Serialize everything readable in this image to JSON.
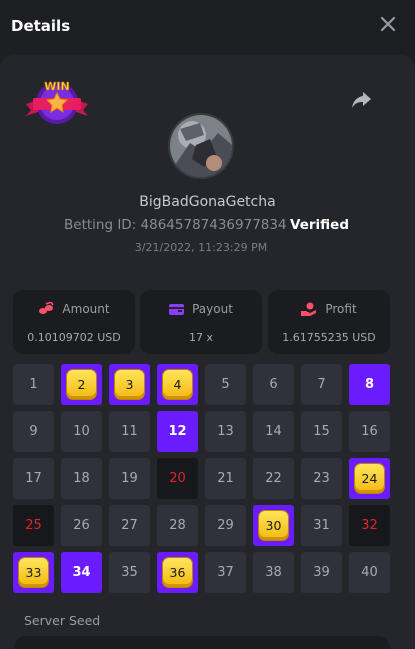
{
  "header": {
    "title": "Details"
  },
  "bet": {
    "username": "BigBadGonaGetcha",
    "betting_id_label": "Betting ID: 486457874369778‌34",
    "status": "Verified",
    "date": "3/21/2022, 11:23:29 PM"
  },
  "badge": {
    "text": "WIN"
  },
  "stats": {
    "amount": {
      "label": "Amount",
      "value": "0.10109702 USD"
    },
    "payout": {
      "label": "Payout",
      "value": "17 x"
    },
    "profit": {
      "label": "Profit",
      "value": "1.61755235 USD"
    }
  },
  "grid": [
    {
      "n": "1",
      "s": "normal"
    },
    {
      "n": "2",
      "s": "gem"
    },
    {
      "n": "3",
      "s": "gem"
    },
    {
      "n": "4",
      "s": "gem"
    },
    {
      "n": "5",
      "s": "normal"
    },
    {
      "n": "6",
      "s": "normal"
    },
    {
      "n": "7",
      "s": "normal"
    },
    {
      "n": "8",
      "s": "purple"
    },
    {
      "n": "9",
      "s": "normal"
    },
    {
      "n": "10",
      "s": "normal"
    },
    {
      "n": "11",
      "s": "normal"
    },
    {
      "n": "12",
      "s": "purple"
    },
    {
      "n": "13",
      "s": "normal"
    },
    {
      "n": "14",
      "s": "normal"
    },
    {
      "n": "15",
      "s": "normal"
    },
    {
      "n": "16",
      "s": "normal"
    },
    {
      "n": "17",
      "s": "normal"
    },
    {
      "n": "18",
      "s": "normal"
    },
    {
      "n": "19",
      "s": "normal"
    },
    {
      "n": "20",
      "s": "dark"
    },
    {
      "n": "21",
      "s": "normal"
    },
    {
      "n": "22",
      "s": "normal"
    },
    {
      "n": "23",
      "s": "normal"
    },
    {
      "n": "24",
      "s": "gem"
    },
    {
      "n": "25",
      "s": "dark"
    },
    {
      "n": "26",
      "s": "normal"
    },
    {
      "n": "27",
      "s": "normal"
    },
    {
      "n": "28",
      "s": "normal"
    },
    {
      "n": "29",
      "s": "normal"
    },
    {
      "n": "30",
      "s": "gem"
    },
    {
      "n": "31",
      "s": "normal"
    },
    {
      "n": "32",
      "s": "dark"
    },
    {
      "n": "33",
      "s": "gem"
    },
    {
      "n": "34",
      "s": "purple"
    },
    {
      "n": "35",
      "s": "normal"
    },
    {
      "n": "36",
      "s": "gem"
    },
    {
      "n": "37",
      "s": "normal"
    },
    {
      "n": "38",
      "s": "normal"
    },
    {
      "n": "39",
      "s": "normal"
    },
    {
      "n": "40",
      "s": "normal"
    }
  ],
  "seed": {
    "label": "Server Seed"
  },
  "colors": {
    "accent_purple": "#6a1cff",
    "gem_yellow": "#f2c21b",
    "loss_red": "#e0242b",
    "stat_icon_pink": "#ff4f6d",
    "stat_icon_purple": "#8b3dff"
  },
  "icons": {
    "close": "close-icon",
    "share": "share-arrow-icon",
    "amount": "coins-icon",
    "payout": "wallet-icon",
    "profit": "hand-coin-icon"
  }
}
